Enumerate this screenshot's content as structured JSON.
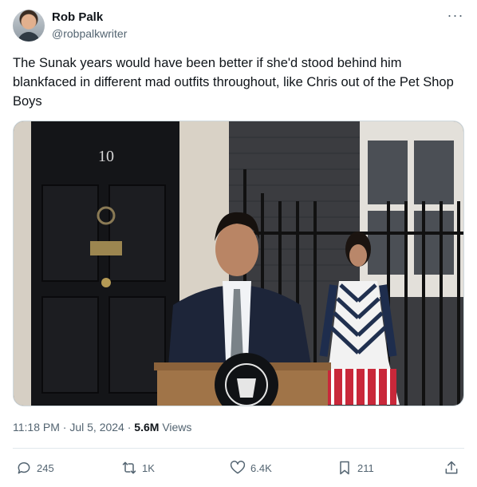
{
  "author": {
    "name": "Rob Palk",
    "handle": "@robpalkwriter"
  },
  "tweet": {
    "text": "The Sunak years would have been better if she'd stood behind him blankfaced in different mad outfits throughout, like Chris out of the Pet Shop Boys"
  },
  "media": {
    "door_number": "10"
  },
  "meta": {
    "time": "11:18 PM",
    "separator": " · ",
    "date": "Jul 5, 2024",
    "views_count": "5.6M",
    "views_label": "Views"
  },
  "actions": {
    "reply_count": "245",
    "retweet_count": "1K",
    "like_count": "6.4K",
    "bookmark_count": "211"
  },
  "icons": {
    "more": "more-options-icon",
    "reply": "reply-icon",
    "retweet": "retweet-icon",
    "like": "heart-icon",
    "bookmark": "bookmark-icon",
    "share": "share-icon"
  },
  "colors": {
    "text_primary": "#0f1419",
    "text_secondary": "#536471",
    "divider": "#e1e8ed"
  }
}
